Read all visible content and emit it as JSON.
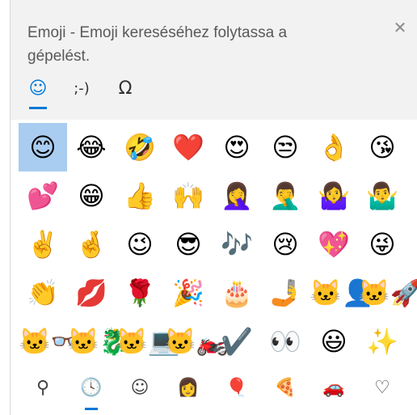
{
  "header": {
    "title": "Emoji - Emoji kereséséhez folytassa a gépelést.",
    "close_glyph": "✕"
  },
  "tabs": [
    {
      "name": "emoji-tab",
      "glyph": "☺",
      "active": true
    },
    {
      "name": "kaomoji-tab",
      "glyph": ";-)",
      "active": false
    },
    {
      "name": "symbols-tab",
      "glyph": "Ω",
      "active": false
    }
  ],
  "emoji_grid": [
    [
      "😊",
      "😂",
      "🤣",
      "❤️",
      "😍",
      "😒",
      "👌",
      "😘"
    ],
    [
      "💕",
      "😁",
      "👍",
      "🙌",
      "🤦‍♀️",
      "🤦‍♂️",
      "🤷‍♀️",
      "🤷‍♂️"
    ],
    [
      "✌️",
      "🤞",
      "😉",
      "😎",
      "🎶",
      "😢",
      "💖",
      "😜"
    ],
    [
      "👏",
      "💋",
      "🌹",
      "🎉",
      "🎂",
      "🤳",
      "🐱‍👤",
      "🐱‍🚀"
    ],
    [
      "🐱‍👓",
      "🐱‍🐉",
      "🐱‍💻",
      "🐱‍🏍",
      "✔️",
      "👀",
      "😃",
      "✨"
    ]
  ],
  "selected_cell": [
    0,
    0
  ],
  "categories": [
    {
      "name": "search-category",
      "glyph": "⚲",
      "active": false
    },
    {
      "name": "recent-category",
      "glyph": "🕓",
      "active": true
    },
    {
      "name": "smileys-category",
      "glyph": "☺",
      "active": false
    },
    {
      "name": "people-category",
      "glyph": "👩",
      "active": false
    },
    {
      "name": "celebration-category",
      "glyph": "🎈",
      "active": false
    },
    {
      "name": "food-category",
      "glyph": "🍕",
      "active": false
    },
    {
      "name": "travel-category",
      "glyph": "🚗",
      "active": false
    },
    {
      "name": "symbols-category",
      "glyph": "♡",
      "active": false
    }
  ],
  "colors": {
    "accent": "#0078d7",
    "selection": "#a9cdf0",
    "header_bg": "#f2f2f2"
  }
}
